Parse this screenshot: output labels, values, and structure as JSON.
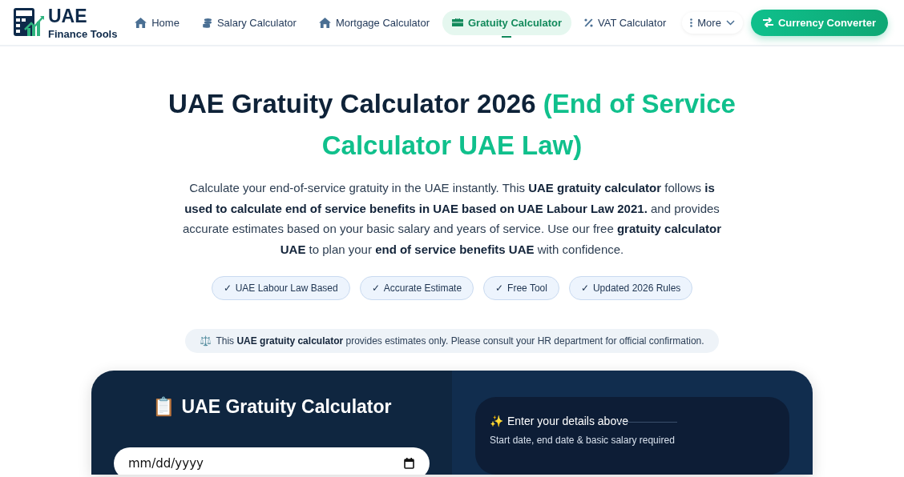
{
  "header": {
    "logo": {
      "title": "UAE",
      "subtitle": "Finance Tools"
    },
    "nav": [
      {
        "label": "Home",
        "kind": "home",
        "selected": false
      },
      {
        "label": "Salary Calculator",
        "kind": "coins",
        "selected": false
      },
      {
        "label": "Mortgage Calculator",
        "kind": "home",
        "selected": false
      },
      {
        "label": "Gratuity Calculator",
        "kind": "briefcase",
        "selected": true
      },
      {
        "label": "VAT Calculator",
        "kind": "percent",
        "selected": false
      }
    ],
    "more": {
      "label": "More",
      "expanded": false
    },
    "cta": {
      "label": "Currency Converter"
    }
  },
  "hero": {
    "title": "UAE Gratuity Calculator 2026",
    "title_accent": "(End of Service Calculator UAE Law)",
    "intro": "Calculate your end-of-service gratuity in the UAE instantly. This **UAE gratuity calculator** follows **is used to calculate end of service benefits in UAE based on UAE Labour Law 2021.** and provides accurate estimates based on your basic salary and years of service. Use our free **gratuity calculator UAE** to plan your **end of service benefits UAE** with confidence.",
    "badges": [
      {
        "check": "✓",
        "label": "UAE Labour Law Based"
      },
      {
        "check": "✓",
        "label": "Accurate Estimate"
      },
      {
        "check": "✓",
        "label": "Free Tool"
      },
      {
        "check": "✓",
        "label": "Updated 2026 Rules"
      }
    ],
    "notice": {
      "icon": "⚖️",
      "text": "This **UAE gratuity calculator** provides estimates only. Please consult your HR department for official confirmation."
    }
  },
  "calculator": {
    "heading_icon": "📋",
    "heading": "UAE Gratuity Calculator",
    "date_field": {
      "placeholder": "mm/dd/yyyy"
    },
    "result": {
      "icon": "✨",
      "title": "Enter your details above",
      "subtitle": "Start date, end date & basic salary required"
    }
  }
}
